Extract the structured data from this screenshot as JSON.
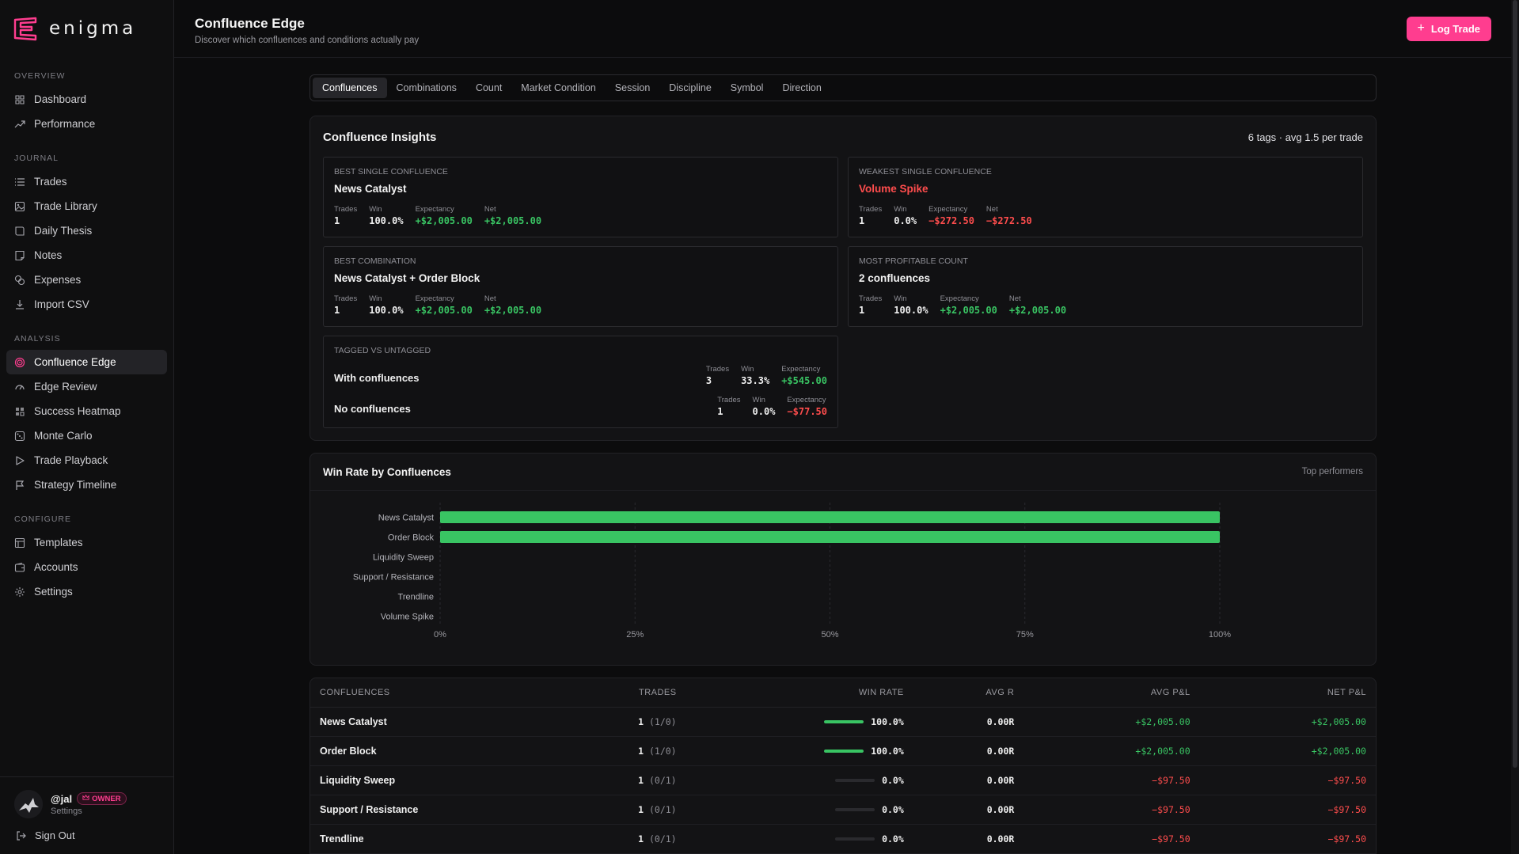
{
  "brand": {
    "name": "enigma",
    "accent": "#ff3d8f"
  },
  "sidebar": {
    "sections": [
      {
        "label": "OVERVIEW",
        "items": [
          {
            "label": "Dashboard",
            "icon": "grid-icon"
          },
          {
            "label": "Performance",
            "icon": "trend-icon"
          }
        ]
      },
      {
        "label": "JOURNAL",
        "items": [
          {
            "label": "Trades",
            "icon": "list-icon"
          },
          {
            "label": "Trade Library",
            "icon": "image-icon"
          },
          {
            "label": "Daily Thesis",
            "icon": "book-icon"
          },
          {
            "label": "Notes",
            "icon": "note-icon"
          },
          {
            "label": "Expenses",
            "icon": "coins-icon"
          },
          {
            "label": "Import CSV",
            "icon": "download-icon"
          }
        ]
      },
      {
        "label": "ANALYSIS",
        "items": [
          {
            "label": "Confluence Edge",
            "icon": "target-icon",
            "active": true
          },
          {
            "label": "Edge Review",
            "icon": "gauge-icon"
          },
          {
            "label": "Success Heatmap",
            "icon": "heatmap-icon"
          },
          {
            "label": "Monte Carlo",
            "icon": "dice-icon"
          },
          {
            "label": "Trade Playback",
            "icon": "play-icon"
          },
          {
            "label": "Strategy Timeline",
            "icon": "flag-icon"
          }
        ]
      },
      {
        "label": "CONFIGURE",
        "items": [
          {
            "label": "Templates",
            "icon": "layout-icon"
          },
          {
            "label": "Accounts",
            "icon": "wallet-icon"
          },
          {
            "label": "Settings",
            "icon": "gear-icon"
          }
        ]
      }
    ],
    "user": {
      "name": "@jal",
      "badge": "OWNER",
      "sub": "Settings"
    },
    "signout": "Sign Out"
  },
  "header": {
    "title": "Confluence Edge",
    "subtitle": "Discover which confluences and conditions actually pay",
    "log_button": "Log Trade"
  },
  "tabs": [
    "Confluences",
    "Combinations",
    "Count",
    "Market Condition",
    "Session",
    "Discipline",
    "Symbol",
    "Direction"
  ],
  "active_tab": "Confluences",
  "insights": {
    "title": "Confluence Insights",
    "meta": "6 tags · avg 1.5 per trade",
    "best_single": {
      "label": "BEST SINGLE CONFLUENCE",
      "name": "News Catalyst",
      "trades": "1",
      "win": "100.0%",
      "expectancy": "+$2,005.00",
      "net": "+$2,005.00"
    },
    "weakest_single": {
      "label": "WEAKEST SINGLE CONFLUENCE",
      "name": "Volume Spike",
      "trades": "1",
      "win": "0.0%",
      "expectancy": "−$272.50",
      "net": "−$272.50"
    },
    "best_combination": {
      "label": "BEST COMBINATION",
      "name": "News Catalyst + Order Block",
      "trades": "1",
      "win": "100.0%",
      "expectancy": "+$2,005.00",
      "net": "+$2,005.00"
    },
    "most_profitable_count": {
      "label": "MOST PROFITABLE COUNT",
      "name": "2 confluences",
      "trades": "1",
      "win": "100.0%",
      "expectancy": "+$2,005.00",
      "net": "+$2,005.00"
    },
    "tagged_vs_untagged": {
      "label": "TAGGED VS UNTAGGED",
      "with": {
        "name": "With confluences",
        "trades": "3",
        "win": "33.3%",
        "expectancy": "+$545.00"
      },
      "without": {
        "name": "No confluences",
        "trades": "1",
        "win": "0.0%",
        "expectancy": "−$77.50"
      }
    },
    "stat_labels": {
      "trades": "Trades",
      "win": "Win",
      "expectancy": "Expectancy",
      "net": "Net"
    }
  },
  "chart_data": {
    "type": "bar",
    "orientation": "horizontal",
    "title": "Win Rate by Confluences",
    "subtitle": "Top performers",
    "categories": [
      "News Catalyst",
      "Order Block",
      "Liquidity Sweep",
      "Support / Resistance",
      "Trendline",
      "Volume Spike"
    ],
    "values": [
      100,
      100,
      0,
      0,
      0,
      0
    ],
    "xlim": [
      0,
      100
    ],
    "xticks": [
      "0%",
      "25%",
      "50%",
      "75%",
      "100%"
    ],
    "grid": true,
    "bar_color": "#39c463"
  },
  "table": {
    "headers": [
      "CONFLUENCES",
      "TRADES",
      "WIN RATE",
      "AVG R",
      "AVG P&L",
      "NET P&L"
    ],
    "rows": [
      {
        "name": "News Catalyst",
        "trades": "1",
        "record": "(1/0)",
        "win_rate": 1.0,
        "win_label": "100.0%",
        "avg_r": "0.00R",
        "avg_pnl": "+$2,005.00",
        "net_pnl": "+$2,005.00",
        "positive": true
      },
      {
        "name": "Order Block",
        "trades": "1",
        "record": "(1/0)",
        "win_rate": 1.0,
        "win_label": "100.0%",
        "avg_r": "0.00R",
        "avg_pnl": "+$2,005.00",
        "net_pnl": "+$2,005.00",
        "positive": true
      },
      {
        "name": "Liquidity Sweep",
        "trades": "1",
        "record": "(0/1)",
        "win_rate": 0.0,
        "win_label": "0.0%",
        "avg_r": "0.00R",
        "avg_pnl": "−$97.50",
        "net_pnl": "−$97.50",
        "positive": false
      },
      {
        "name": "Support / Resistance",
        "trades": "1",
        "record": "(0/1)",
        "win_rate": 0.0,
        "win_label": "0.0%",
        "avg_r": "0.00R",
        "avg_pnl": "−$97.50",
        "net_pnl": "−$97.50",
        "positive": false
      },
      {
        "name": "Trendline",
        "trades": "1",
        "record": "(0/1)",
        "win_rate": 0.0,
        "win_label": "0.0%",
        "avg_r": "0.00R",
        "avg_pnl": "−$97.50",
        "net_pnl": "−$97.50",
        "positive": false
      }
    ]
  }
}
